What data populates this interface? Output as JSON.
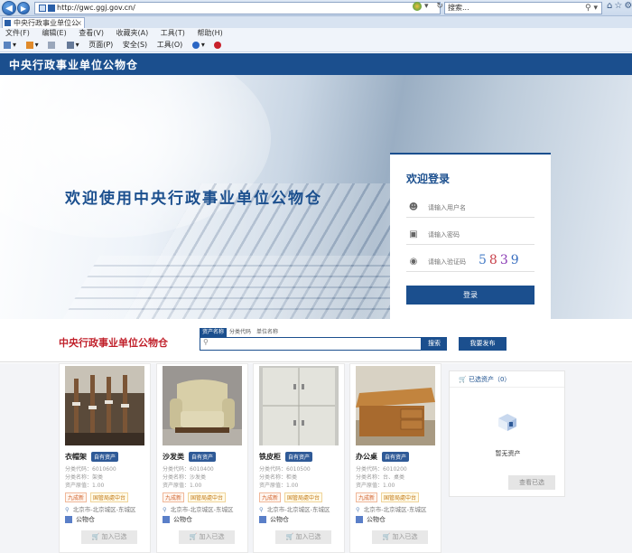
{
  "browser": {
    "url": "http://gwc.ggj.gov.cn/",
    "tab_title": "中央行政事业单位公物仓",
    "search_placeholder": "搜索...",
    "menu": [
      "文件(F)",
      "编辑(E)",
      "查看(V)",
      "收藏夹(A)",
      "工具(T)",
      "帮助(H)"
    ],
    "toolbar": [
      "页面(P)",
      "安全(S)",
      "工具(O)"
    ]
  },
  "header": {
    "title": "中央行政事业单位公物仓"
  },
  "hero": {
    "slogan": "欢迎使用中央行政事业单位公物仓"
  },
  "login": {
    "title": "欢迎登录",
    "username_placeholder": "请输入用户名",
    "password_placeholder": "请输入密码",
    "captcha_placeholder": "请输入验证码",
    "captcha": [
      "5",
      "8",
      "3",
      "9"
    ],
    "submit": "登录"
  },
  "search": {
    "logo": "中央行政事业单位公物仓",
    "tabs": [
      "资产名称",
      "分类代码",
      "单位名称"
    ],
    "button": "搜索",
    "publish": "我要发布"
  },
  "products": [
    {
      "name": "衣帽架",
      "tag": "自有资产",
      "code": "分类代码：6010600",
      "catname": "分类名称：架类",
      "qty": "资产原值：1.00",
      "b1": "九成新",
      "b2": "国管局處中台",
      "location": "北京市-北京城区-东城区",
      "warehouse": "公物仓",
      "add": "加入已选"
    },
    {
      "name": "沙发类",
      "tag": "自有资产",
      "code": "分类代码：6010400",
      "catname": "分类名称：沙发类",
      "qty": "资产原值：1.00",
      "b1": "九成新",
      "b2": "国管局處中台",
      "location": "北京市-北京城区-东城区",
      "warehouse": "公物仓",
      "add": "加入已选"
    },
    {
      "name": "铁皮柜",
      "tag": "自有资产",
      "code": "分类代码：6010500",
      "catname": "分类名称：柜类",
      "qty": "资产原值：1.00",
      "b1": "九成新",
      "b2": "国管局處中台",
      "location": "北京市-北京城区-东城区",
      "warehouse": "公物仓",
      "add": "加入已选"
    },
    {
      "name": "办公桌",
      "tag": "自有资产",
      "code": "分类代码：6010200",
      "catname": "分类名称：台、桌类",
      "qty": "资产原值：1.00",
      "b1": "九成新",
      "b2": "国管局處中台",
      "location": "北京市-北京城区-东城区",
      "warehouse": "公物仓",
      "add": "加入已选"
    }
  ],
  "selected": {
    "title": "已选资产（0）",
    "empty": "暂无资产",
    "view": "查看已选"
  }
}
